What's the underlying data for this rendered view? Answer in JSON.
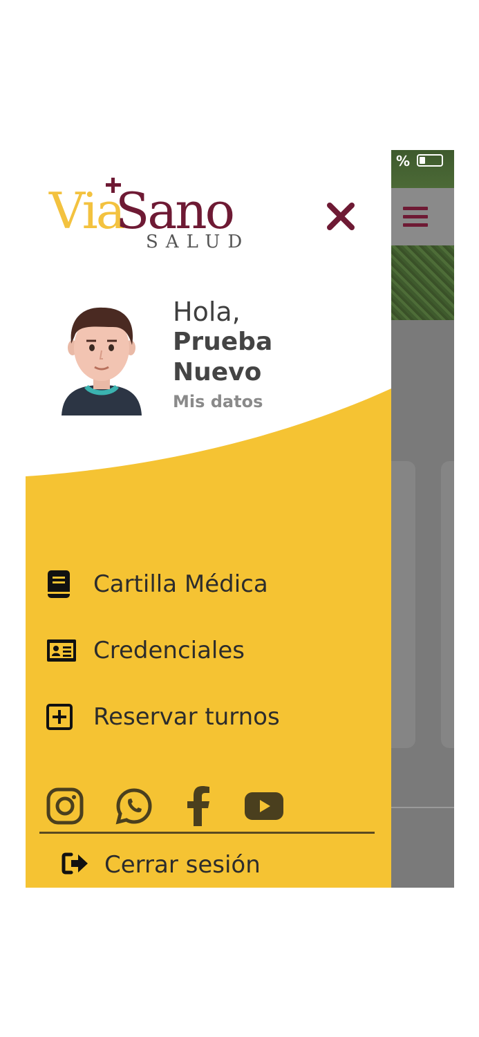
{
  "app": {
    "logo_via": "Via",
    "logo_sano": "Sano",
    "logo_salud": "SALUD"
  },
  "background": {
    "status_text": "%",
    "menu_icon": "hamburger-icon"
  },
  "drawer": {
    "close_icon": "close-icon",
    "greeting": "Hola,",
    "user_first": "Prueba",
    "user_last": "Nuevo",
    "profile_link": "Mis datos",
    "menu": [
      {
        "label": "Cartilla Médica",
        "icon": "book-icon"
      },
      {
        "label": "Credenciales",
        "icon": "id-card-icon"
      },
      {
        "label": "Reservar turnos",
        "icon": "plus-square-icon"
      }
    ],
    "social": [
      "instagram-icon",
      "whatsapp-icon",
      "facebook-icon",
      "youtube-icon"
    ],
    "logout_label": "Cerrar sesión",
    "logout_icon": "sign-out-icon"
  },
  "colors": {
    "brand_wine": "#6e1a34",
    "brand_yellow": "#f5c333",
    "text_dark": "#2c2c2c"
  }
}
